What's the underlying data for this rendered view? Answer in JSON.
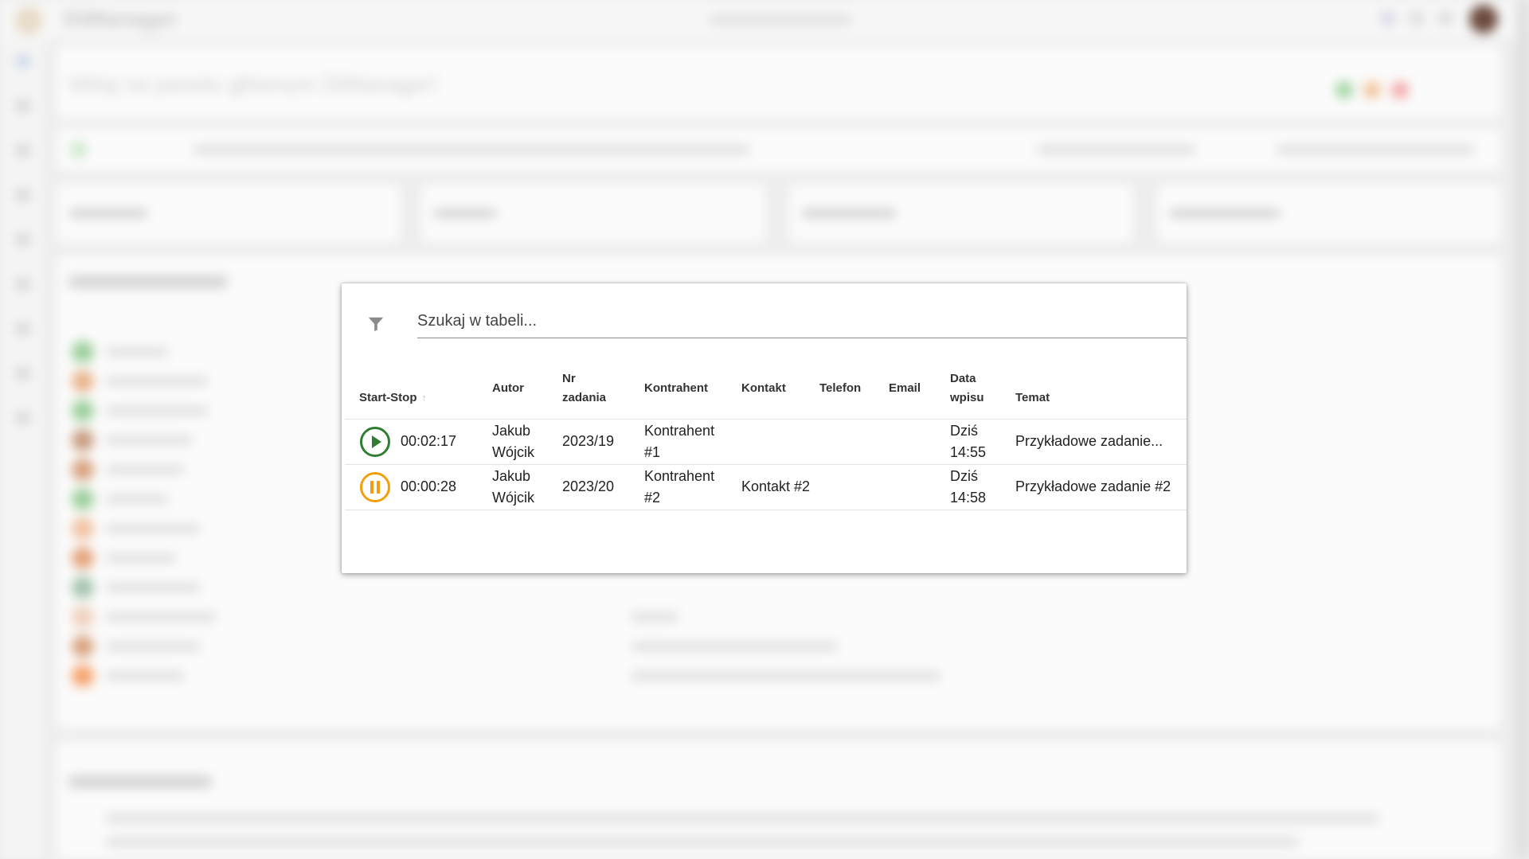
{
  "background": {
    "app_title": "DiManager",
    "welcome": "Witaj na panelu głównym DiManager!"
  },
  "search": {
    "placeholder": "Szukaj w tabeli..."
  },
  "table": {
    "headers": {
      "start_stop": "Start-Stop",
      "author": "Autor",
      "task_no": "Nr zadania",
      "contractor": "Kontrahent",
      "contact": "Kontakt",
      "phone": "Telefon",
      "email": "Email",
      "entry_date": "Data wpisu",
      "subject": "Temat"
    },
    "rows": [
      {
        "state": "stopped",
        "control_icon": "play-icon",
        "control_color": "#2e7d32",
        "timer": "00:02:17",
        "author": "Jakub Wójcik",
        "task_no": "2023/19",
        "contractor": "Kontrahent #1",
        "contact": "",
        "phone": "",
        "email": "",
        "entry_date": "Dziś 14:55",
        "subject": "Przykładowe zadanie..."
      },
      {
        "state": "running",
        "control_icon": "pause-icon",
        "control_color": "#f59e0b",
        "timer": "00:00:28",
        "author": "Jakub Wójcik",
        "task_no": "2023/20",
        "contractor": "Kontrahent #2",
        "contact": "Kontakt #2",
        "phone": "",
        "email": "",
        "entry_date": "Dziś 14:58",
        "subject": "Przykładowe zadanie #2"
      }
    ]
  }
}
